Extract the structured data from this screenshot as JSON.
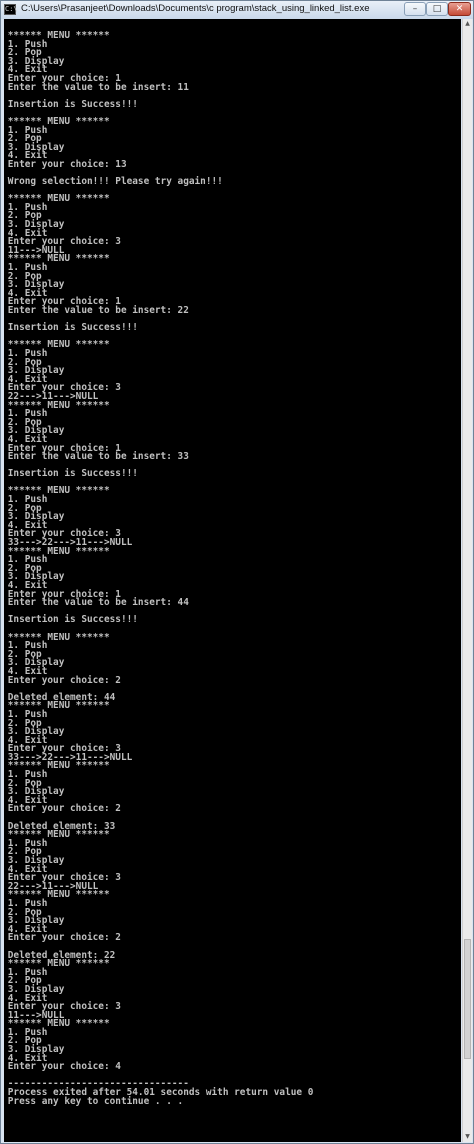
{
  "window": {
    "title": "C:\\Users\\Prasanjeet\\Downloads\\Documents\\c program\\stack_using_linked_list.exe",
    "icon_label": "C:\\",
    "buttons": {
      "minimize": "–",
      "maximize": "□",
      "close": "✕"
    },
    "scroll_up": "▲",
    "scroll_down": "▼"
  },
  "console": {
    "lines": [
      "****** MENU ******",
      "1. Push",
      "2. Pop",
      "3. Display",
      "4. Exit",
      "Enter your choice: 1",
      "Enter the value to be insert: 11",
      "",
      "Insertion is Success!!!",
      "",
      "****** MENU ******",
      "1. Push",
      "2. Pop",
      "3. Display",
      "4. Exit",
      "Enter your choice: 13",
      "",
      "Wrong selection!!! Please try again!!!",
      "",
      "****** MENU ******",
      "1. Push",
      "2. Pop",
      "3. Display",
      "4. Exit",
      "Enter your choice: 3",
      "11--->NULL",
      "****** MENU ******",
      "1. Push",
      "2. Pop",
      "3. Display",
      "4. Exit",
      "Enter your choice: 1",
      "Enter the value to be insert: 22",
      "",
      "Insertion is Success!!!",
      "",
      "****** MENU ******",
      "1. Push",
      "2. Pop",
      "3. Display",
      "4. Exit",
      "Enter your choice: 3",
      "22--->11--->NULL",
      "****** MENU ******",
      "1. Push",
      "2. Pop",
      "3. Display",
      "4. Exit",
      "Enter your choice: 1",
      "Enter the value to be insert: 33",
      "",
      "Insertion is Success!!!",
      "",
      "****** MENU ******",
      "1. Push",
      "2. Pop",
      "3. Display",
      "4. Exit",
      "Enter your choice: 3",
      "33--->22--->11--->NULL",
      "****** MENU ******",
      "1. Push",
      "2. Pop",
      "3. Display",
      "4. Exit",
      "Enter your choice: 1",
      "Enter the value to be insert: 44",
      "",
      "Insertion is Success!!!",
      "",
      "****** MENU ******",
      "1. Push",
      "2. Pop",
      "3. Display",
      "4. Exit",
      "Enter your choice: 2",
      "",
      "Deleted element: 44",
      "****** MENU ******",
      "1. Push",
      "2. Pop",
      "3. Display",
      "4. Exit",
      "Enter your choice: 3",
      "33--->22--->11--->NULL",
      "****** MENU ******",
      "1. Push",
      "2. Pop",
      "3. Display",
      "4. Exit",
      "Enter your choice: 2",
      "",
      "Deleted element: 33",
      "****** MENU ******",
      "1. Push",
      "2. Pop",
      "3. Display",
      "4. Exit",
      "Enter your choice: 3",
      "22--->11--->NULL",
      "****** MENU ******",
      "1. Push",
      "2. Pop",
      "3. Display",
      "4. Exit",
      "Enter your choice: 2",
      "",
      "Deleted element: 22",
      "****** MENU ******",
      "1. Push",
      "2. Pop",
      "3. Display",
      "4. Exit",
      "Enter your choice: 3",
      "11--->NULL",
      "****** MENU ******",
      "1. Push",
      "2. Pop",
      "3. Display",
      "4. Exit",
      "Enter your choice: 4",
      "",
      "--------------------------------",
      "Process exited after 54.01 seconds with return value 0",
      "Press any key to continue . . ."
    ]
  },
  "colors": {
    "console_background": "#000000",
    "console_text": "#c0c0c0",
    "titlebar": "#d9e4f1",
    "close_button": "#c44a36"
  }
}
